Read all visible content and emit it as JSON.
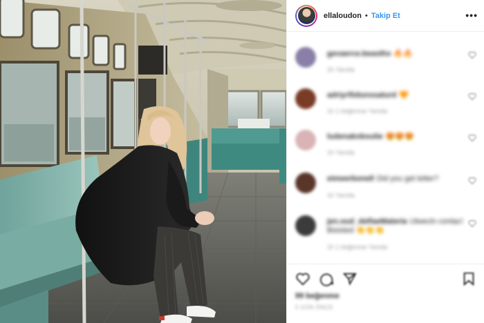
{
  "header": {
    "username": "ellaloudon",
    "separator": "•",
    "follow_label": "Takip Et",
    "more_label": "•••"
  },
  "comments": [
    {
      "user": "gevaerce.beasths",
      "text": "🔥🔥",
      "meta": "2h   Yanıtla",
      "extra": "",
      "avatar_color": "#8a7fa8"
    },
    {
      "user": "adriyrfiidunssaturd",
      "text": "🧡",
      "meta": "1h   1 beğenme   Yanıtla",
      "extra": "",
      "avatar_color": "#7a3b26"
    },
    {
      "user": "ludenaknbsutie",
      "text": "😍😍😍",
      "meta": "1h   Yanıtla",
      "extra": "",
      "avatar_color": "#d9b3b6"
    },
    {
      "user": "eimeerbonell",
      "text": "Did you get letter?",
      "meta": "1h   Yanıtla",
      "extra": "",
      "avatar_color": "#5a3529"
    },
    {
      "user": "jen.oud_delfaeMateria",
      "text": "Ulwecln contac!",
      "meta": "1h   1 beğenme   Yanıtla",
      "extra": "Bisisted 👏👏👏",
      "avatar_color": "#3b3b3b"
    }
  ],
  "footer": {
    "likes": "99 beğenme",
    "date": "5 GÜN ÖNCE"
  },
  "colors": {
    "accent": "#3897f0",
    "text": "#262626",
    "muted": "#999999",
    "divider": "#efefef"
  },
  "icons": [
    "heart-icon",
    "comment-icon",
    "share-icon",
    "bookmark-icon",
    "more-options-icon"
  ]
}
